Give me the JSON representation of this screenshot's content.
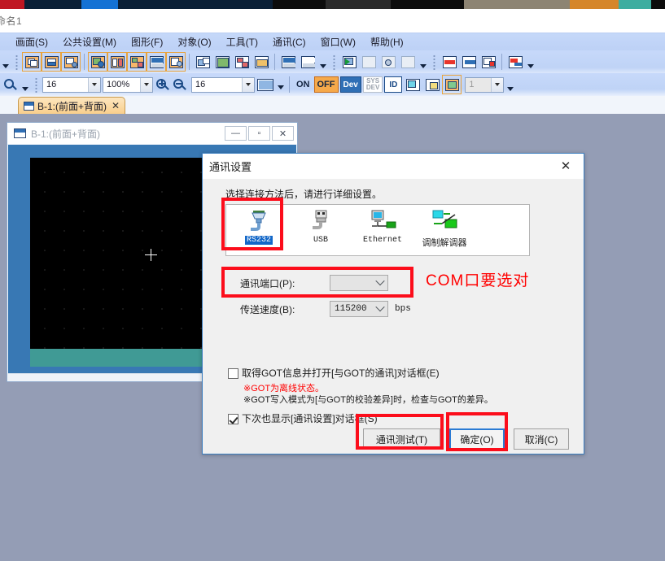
{
  "app": {
    "title": "命名1",
    "menubar": [
      {
        "label": "画面(S)",
        "name": "menu-screen"
      },
      {
        "label": "公共设置(M)",
        "name": "menu-common"
      },
      {
        "label": "图形(F)",
        "name": "menu-figure"
      },
      {
        "label": "对象(O)",
        "name": "menu-object"
      },
      {
        "label": "工具(T)",
        "name": "menu-tool"
      },
      {
        "label": "通讯(C)",
        "name": "menu-comm"
      },
      {
        "label": "窗口(W)",
        "name": "menu-window"
      },
      {
        "label": "帮助(H)",
        "name": "menu-help"
      }
    ]
  },
  "toolbar2": {
    "font_size": "16",
    "zoom_level": "100%",
    "grid_size": "16",
    "on_label": "ON",
    "off_label": "OFF",
    "dev_label": "Dev",
    "sysdev_label_top": "SYS",
    "sysdev_label_bottom": "DEV",
    "id_label": "ID",
    "layer_number": "1"
  },
  "tab": {
    "label": "B-1:(前面+背面)",
    "close": "✕"
  },
  "mdi": {
    "title": "B-1:(前面+背面)",
    "minimize": "—",
    "restore": "▫",
    "close": "✕"
  },
  "dialog": {
    "title": "通讯设置",
    "close": "✕",
    "hint": "选择连接方法后，请进行详细设置。",
    "connections": [
      {
        "label": "RS232",
        "name": "conn-rs232",
        "selected": true
      },
      {
        "label": "USB",
        "name": "conn-usb",
        "selected": false
      },
      {
        "label": "Ethernet",
        "name": "conn-ethernet",
        "selected": false
      },
      {
        "label": "调制解调器",
        "name": "conn-modem",
        "selected": false
      }
    ],
    "port": {
      "label": "通讯端口(P):",
      "value": ""
    },
    "baud": {
      "label": "传送速度(B):",
      "value": "115200",
      "unit": "bps"
    },
    "annotation": "COM口要选对",
    "checkbox_got": {
      "label": "取得GOT信息并打开[与GOT的通讯]对话框(E)",
      "checked": false,
      "note_red": "※GOT为离线状态。",
      "note_black": "※GOT写入模式为[与GOT的校验差异]时，检查与GOT的差异。"
    },
    "checkbox_show_next": {
      "label": "下次也显示[通讯设置]对话框(S)",
      "checked": true
    },
    "buttons": {
      "test": "通讯测试(T)",
      "ok": "确定(O)",
      "cancel": "取消(C)"
    }
  },
  "colors": {
    "annotation_red": "#ff0000",
    "highlight_box": "#fc0d1b",
    "selection_blue": "#1267c8",
    "workspace": "#949db5",
    "toolbar": "#bfd3f6",
    "canvas": "#000000",
    "canvas_band": "#409a95"
  }
}
